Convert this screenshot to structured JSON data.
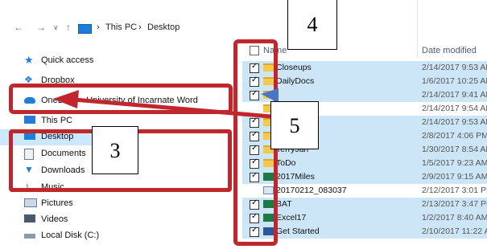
{
  "address_bar": {
    "back": "←",
    "forward": "→",
    "dropdown": "∨",
    "up": "↑",
    "sep1": "›",
    "crumb1": "This PC",
    "sep2": "›",
    "crumb2": "Desktop"
  },
  "nav_pane": {
    "items": [
      {
        "label": "Quick access",
        "icon": "star-icon"
      },
      {
        "label": "Dropbox",
        "icon": "dropbox-icon"
      },
      {
        "label": "OneDrive - University of Incarnate Word",
        "icon": "cloud-icon"
      },
      {
        "label": "This PC",
        "icon": "computer-icon"
      },
      {
        "label": "Desktop",
        "icon": "desktop-icon"
      },
      {
        "label": "Documents",
        "icon": "documents-icon"
      },
      {
        "label": "Downloads",
        "icon": "download-icon"
      },
      {
        "label": "Music",
        "icon": "music-icon"
      },
      {
        "label": "Pictures",
        "icon": "pictures-icon"
      },
      {
        "label": "Videos",
        "icon": "videos-icon"
      },
      {
        "label": "Local Disk (C:)",
        "icon": "disk-icon"
      }
    ]
  },
  "file_list": {
    "col_name": "Name",
    "col_date": "Date modified",
    "rows": [
      {
        "name": "Closeups",
        "date": "2/14/2017 9:53 AM",
        "type": "folder",
        "checked": true
      },
      {
        "name": "DailyDocs",
        "date": "1/6/2017 10:25 AM",
        "type": "folder",
        "checked": true
      },
      {
        "name": "",
        "date": "2/14/2017 9:41 AM",
        "type": "folder",
        "checked": true
      },
      {
        "name": "",
        "date": "2/14/2017 9:54 AM",
        "type": "folder",
        "checked": false
      },
      {
        "name": "",
        "date": "2/14/2017 9:53 AM",
        "type": "folder",
        "checked": true
      },
      {
        "name": "",
        "date": "2/8/2017 4:06 PM",
        "type": "folder",
        "checked": true
      },
      {
        "name": "TerryJan",
        "date": "1/30/2017 8:54 AM",
        "type": "folder",
        "checked": true
      },
      {
        "name": "ToDo",
        "date": "1/5/2017 9:23 AM",
        "type": "folder",
        "checked": true
      },
      {
        "name": "2017Miles",
        "date": "2/9/2017 9:15 AM",
        "type": "excel",
        "checked": true
      },
      {
        "name": "20170212_083037",
        "date": "2/12/2017 3:01 PM",
        "type": "image",
        "checked": false
      },
      {
        "name": "BAT",
        "date": "2/13/2017 3:47 PM",
        "type": "excel",
        "checked": true
      },
      {
        "name": "Excel17",
        "date": "1/2/2017 8:40 AM",
        "type": "excel",
        "checked": true
      },
      {
        "name": "Get Started",
        "date": "2/10/2017 11:22 AM",
        "type": "word",
        "checked": true
      }
    ]
  },
  "annotations": {
    "n3": "3",
    "n4": "4",
    "n5": "5",
    "accent": "#c0262b"
  }
}
